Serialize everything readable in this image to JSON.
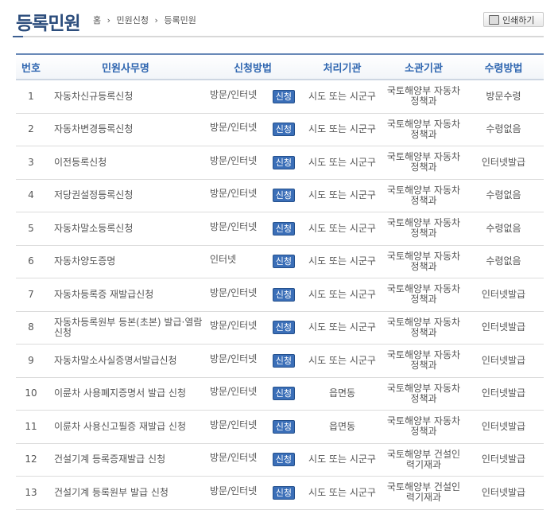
{
  "page": {
    "title": "등록민원",
    "breadcrumb": [
      "홈",
      "민원신청",
      "등록민원"
    ],
    "print_label": "인쇄하기"
  },
  "table": {
    "headers": [
      "번호",
      "민원사무명",
      "신청방법",
      "처리기관",
      "소관기관",
      "수령방법"
    ],
    "apply_label": "신청",
    "rows": [
      {
        "no": "1",
        "name": "자동차신규등록신청",
        "method": "방문/인터넷",
        "office": "시도 또는 시군구",
        "org": "국토해양부 자동차정책과",
        "receive": "방문수령"
      },
      {
        "no": "2",
        "name": "자동차변경등록신청",
        "method": "방문/인터넷",
        "office": "시도 또는 시군구",
        "org": "국토해양부 자동차정책과",
        "receive": "수령없음"
      },
      {
        "no": "3",
        "name": "이전등록신청",
        "method": "방문/인터넷",
        "office": "시도 또는 시군구",
        "org": "국토해양부 자동차정책과",
        "receive": "인터넷발급"
      },
      {
        "no": "4",
        "name": "저당권설정등록신청",
        "method": "방문/인터넷",
        "office": "시도 또는 시군구",
        "org": "국토해양부 자동차정책과",
        "receive": "수령없음"
      },
      {
        "no": "5",
        "name": "자동차말소등록신청",
        "method": "방문/인터넷",
        "office": "시도 또는 시군구",
        "org": "국토해양부 자동차정책과",
        "receive": "수령없음"
      },
      {
        "no": "6",
        "name": "자동차양도증명",
        "method": "인터넷",
        "office": "시도 또는 시군구",
        "org": "국토해양부 자동차정책과",
        "receive": "수령없음"
      },
      {
        "no": "7",
        "name": "자동차등록증 재발급신청",
        "method": "방문/인터넷",
        "office": "시도 또는 시군구",
        "org": "국토해양부 자동차정책과",
        "receive": "인터넷발급"
      },
      {
        "no": "8",
        "name": "자동차등록원부 등본(초본) 발급·열람신청",
        "method": "방문/인터넷",
        "office": "시도 또는 시군구",
        "org": "국토해양부 자동차정책과",
        "receive": "인터넷발급"
      },
      {
        "no": "9",
        "name": "자동차말소사실증명서발급신청",
        "method": "방문/인터넷",
        "office": "시도 또는 시군구",
        "org": "국토해양부 자동차정책과",
        "receive": "인터넷발급"
      },
      {
        "no": "10",
        "name": "이륜차 사용폐지증명서 발급 신청",
        "method": "방문/인터넷",
        "office": "읍면동",
        "org": "국토해양부 자동차정책과",
        "receive": "인터넷발급"
      },
      {
        "no": "11",
        "name": "이륜차 사용신고필증 재발급 신청",
        "method": "방문/인터넷",
        "office": "읍면동",
        "org": "국토해양부 자동차정책과",
        "receive": "인터넷발급"
      },
      {
        "no": "12",
        "name": "건설기계 등록증재발급 신청",
        "method": "방문/인터넷",
        "office": "시도 또는 시군구",
        "org": "국토해양부 건설인력기재과",
        "receive": "인터넷발급"
      },
      {
        "no": "13",
        "name": "건설기계 등록원부 발급 신청",
        "method": "방문/인터넷",
        "office": "시도 또는 시군구",
        "org": "국토해양부 건설인력기재과",
        "receive": "인터넷발급"
      }
    ]
  }
}
